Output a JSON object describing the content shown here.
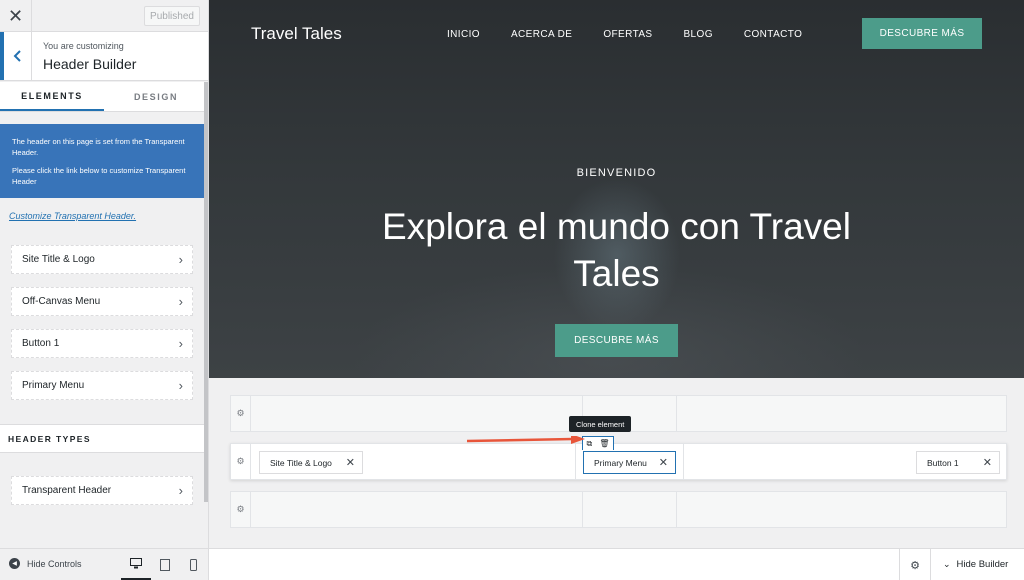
{
  "sidebar": {
    "close_label": "✕",
    "published_label": "Published",
    "customizing_small": "You are customizing",
    "customizing_title": "Header Builder",
    "tabs": [
      {
        "label": "ELEMENTS"
      },
      {
        "label": "DESIGN"
      }
    ],
    "notice_line1": "The header on this page is set from the Transparent Header.",
    "notice_line2": "Please click the link below to customize Transparent Header",
    "customize_link": "Customize Transparent Header.",
    "elements": [
      {
        "label": "Site Title & Logo"
      },
      {
        "label": "Off-Canvas Menu"
      },
      {
        "label": "Button 1"
      },
      {
        "label": "Primary Menu"
      }
    ],
    "header_types_label": "HEADER TYPES",
    "header_types": [
      {
        "label": "Transparent Header"
      }
    ],
    "hide_controls_label": "Hide Controls"
  },
  "preview": {
    "site_title": "Travel Tales",
    "nav": [
      "INICIO",
      "ACERCA DE",
      "OFERTAS",
      "BLOG",
      "CONTACTO"
    ],
    "header_cta": "DESCUBRE MÁS",
    "welcome": "BIENVENIDO",
    "hero_title": "Explora el mundo con Travel Tales",
    "hero_cta": "DESCUBRE MÁS"
  },
  "builder": {
    "tooltip": "Clone element",
    "chips": {
      "site_title": "Site Title & Logo",
      "primary_menu": "Primary Menu",
      "button1": "Button 1"
    },
    "hide_builder_label": "Hide Builder"
  },
  "colors": {
    "accent": "#2271b1",
    "notice_bg": "#3874b9",
    "cta": "#4c9c8a",
    "annotation_arrow": "#e8553a"
  },
  "icons": {
    "close": "close-icon",
    "back": "chevron-left-icon",
    "chevron": "chevron-right-icon",
    "gear": "gear-icon",
    "clone": "copy-icon",
    "delete": "trash-icon"
  }
}
